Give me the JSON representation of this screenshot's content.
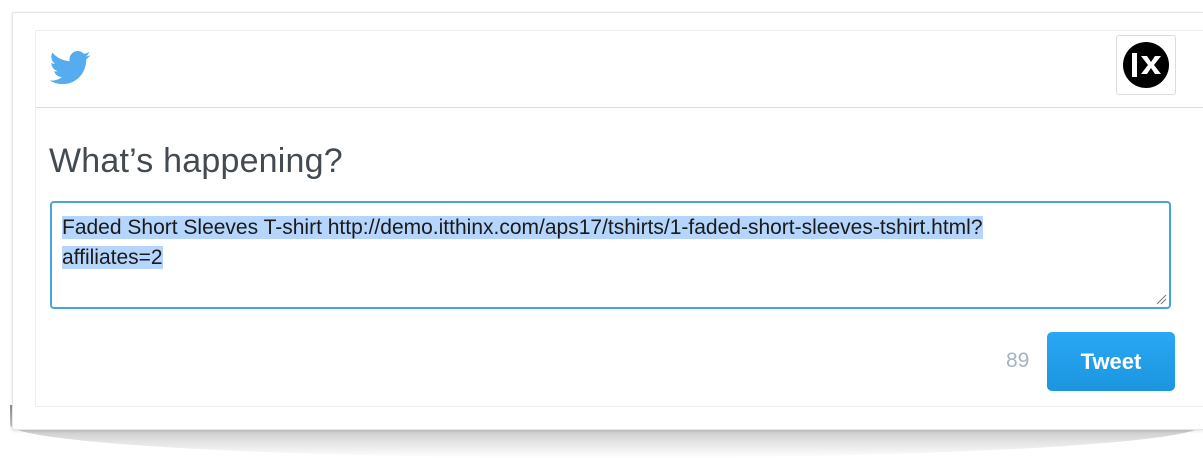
{
  "header": {
    "logo_icon": "twitter-bird-icon",
    "close_icon": "close-icon",
    "brand_color": "#55acee"
  },
  "compose": {
    "heading": "What’s happening?",
    "text_line1": "Faded Short Sleeves T-shirt http://demo.itthinx.com/aps17/tshirts/1-faded-short-sleeves-tshirt.html?",
    "text_line2": "affiliates=2",
    "text_selected": true,
    "border_color": "#47a3e0"
  },
  "footer": {
    "char_count": "89",
    "tweet_label": "Tweet",
    "button_color": "#1da1f2"
  }
}
